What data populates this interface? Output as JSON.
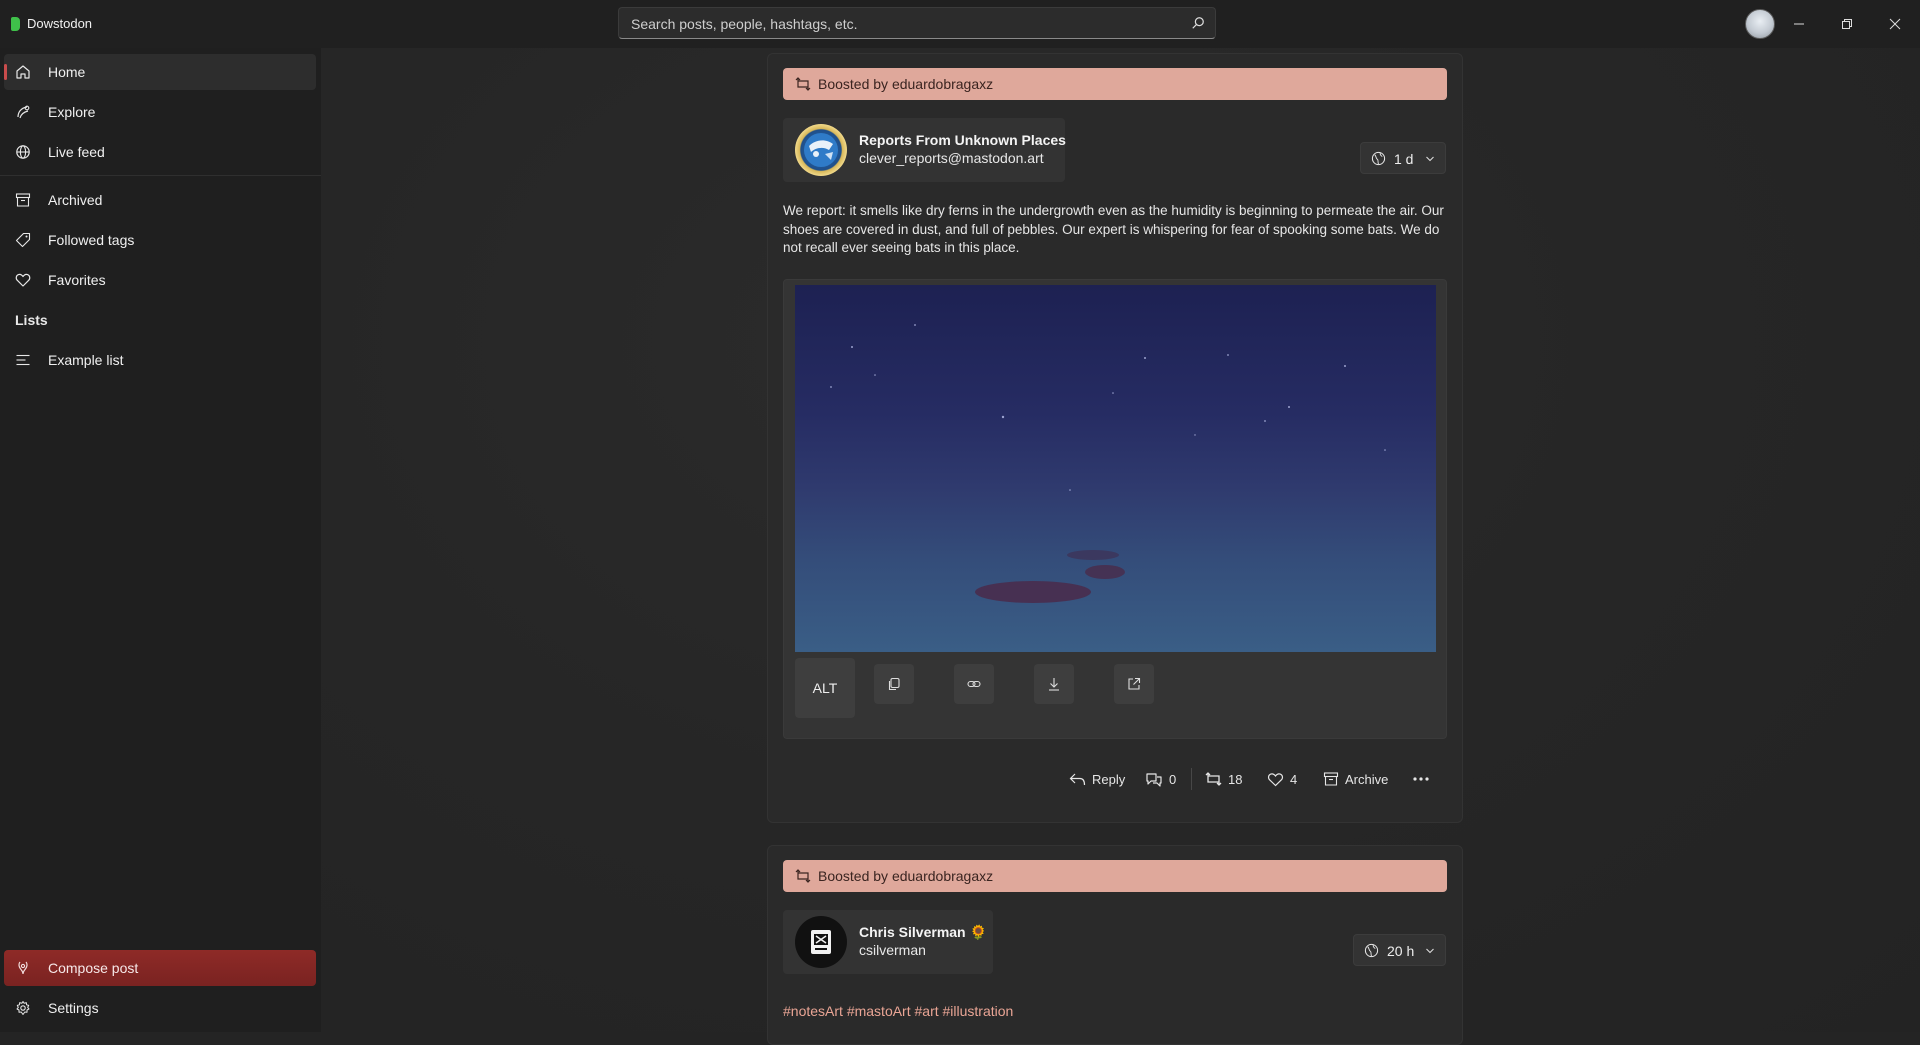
{
  "app": {
    "name": "Dowstodon"
  },
  "search": {
    "placeholder": "Search posts, people, hashtags, etc."
  },
  "sidebar": {
    "items": [
      {
        "label": "Home",
        "icon": "home-icon"
      },
      {
        "label": "Explore",
        "icon": "explore-icon"
      },
      {
        "label": "Live feed",
        "icon": "globe-icon"
      },
      {
        "label": "Archived",
        "icon": "archive-icon"
      },
      {
        "label": "Followed tags",
        "icon": "tag-icon"
      },
      {
        "label": "Favorites",
        "icon": "heart-icon"
      }
    ],
    "lists_header": "Lists",
    "lists": [
      {
        "label": "Example list",
        "icon": "list-icon"
      }
    ],
    "compose_label": "Compose post",
    "settings_label": "Settings"
  },
  "posts": [
    {
      "boosted_by": "Boosted by eduardobragaxz",
      "author_name": "Reports From Unknown Places",
      "author_handle": "clever_reports@mastodon.art",
      "time": "1 d",
      "text": "We report: it smells like dry ferns in the undergrowth even as the humidity is beginning to permeate the air. Our shoes are covered in dust, and full of pebbles. Our expert is whispering for fear of spooking some bats. We do not recall ever seeing bats in this place.",
      "media": {
        "alt_label": "ALT"
      },
      "actions": {
        "reply_label": "Reply",
        "quotes": "0",
        "boosts": "18",
        "favorites": "4",
        "archive_label": "Archive"
      }
    },
    {
      "boosted_by": "Boosted by eduardobragaxz",
      "author_name": "Chris Silverman",
      "author_badge": "🌻",
      "author_handle": "csilverman",
      "time": "20 h",
      "hashtags": "#notesArt #mastoArt #art #illustration"
    }
  ],
  "colors": {
    "accent": "#c94c4c",
    "boost_banner": "#dfa89b",
    "compose": "#8e2a27",
    "hashtag": "#eaa595",
    "app_logo": "#3fc14a"
  }
}
